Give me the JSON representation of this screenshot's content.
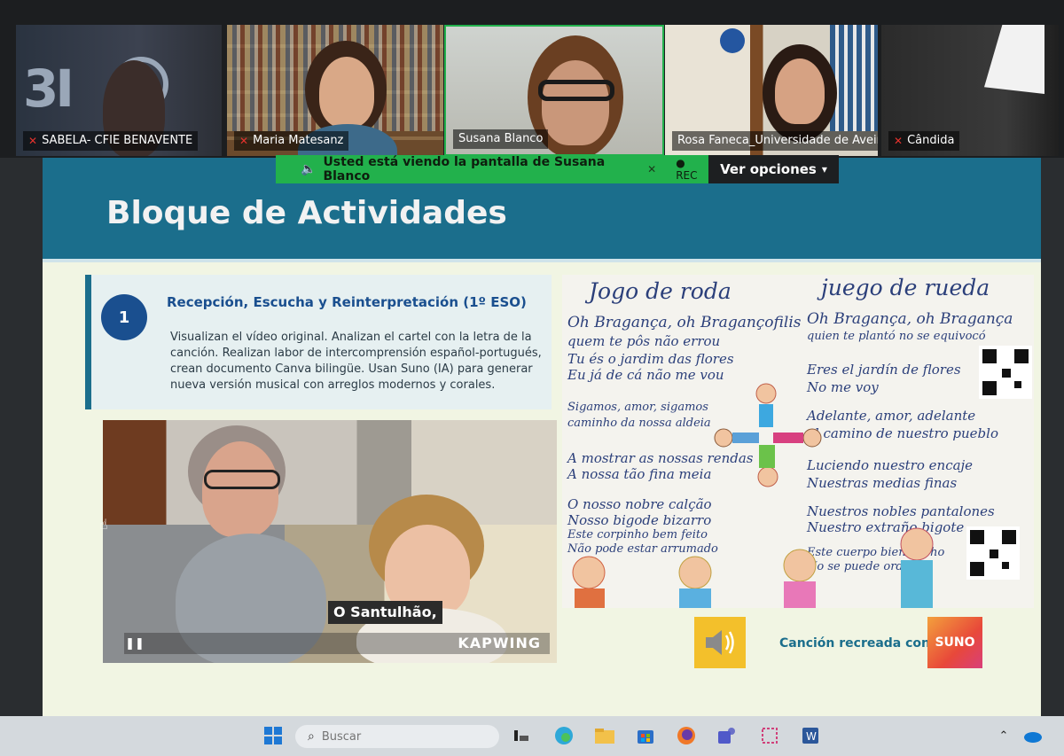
{
  "participants": [
    {
      "name": "SABELA- CFIE BENAVENTE",
      "muted": true
    },
    {
      "name": "Maria Matesanz",
      "muted": true
    },
    {
      "name": "Susana Blanco",
      "muted": false
    },
    {
      "name": "Rosa Faneca_Universidade de Aveiro",
      "muted": false
    },
    {
      "name": "Cândida",
      "muted": true
    }
  ],
  "share_banner": {
    "text": "Usted está viendo la pantalla de  Susana Blanco",
    "rec": "REC",
    "view_options": "Ver opciones"
  },
  "slide": {
    "title": "Bloque de Actividades",
    "activity": {
      "number": "1",
      "title": "Recepción, Escucha y Reinterpretación (1º ESO)",
      "description": "Visualizan el vídeo original. Analizan el cartel con la letra de la canción. Realizan labor de intercomprensión español-portugués, crean documento Canva bilingüe. Usan Suno (IA) para generar nueva versión musical con arreglos modernos y corales."
    },
    "video": {
      "subtitle": "O Santulhão,",
      "watermark": "KAPWING"
    },
    "drawing": {
      "title_left": "Jogo de roda",
      "title_right": "juego de rueda",
      "left_lines": [
        "Oh Bragança, oh Bragançofilis",
        "quem te pôs não errou",
        "Tu és o jardim das flores",
        "Eu já de cá não me vou",
        "Sigamos, amor, sigamos",
        "caminho da nossa aldeia",
        "A mostrar as nossas rendas",
        "A nossa tão fina meia",
        "O nosso nobre calção",
        "Nosso bigode bizarro",
        "Este corpinho bem feito",
        "Não pode estar arrumado"
      ],
      "right_lines": [
        "Oh Bragança, oh Bragança",
        "quien te plantó no se equivocó",
        "Eres el jardín de flores",
        "No me voy",
        "Adelante, amor, adelante",
        "el camino de nuestro pueblo",
        "Luciendo nuestro encaje",
        "Nuestras medias finas",
        "Nuestros nobles pantalones",
        "Nuestro extraño bigote",
        "Este cuerpo bien hecho",
        "No se puede ordenar"
      ]
    },
    "caption": "Canción recreada con",
    "suno": "SUNO"
  },
  "taskbar": {
    "search_placeholder": "Buscar"
  },
  "colors": {
    "header": "#1b6e8c",
    "banner": "#22b14c",
    "accent_number": "#1a4f8f"
  }
}
